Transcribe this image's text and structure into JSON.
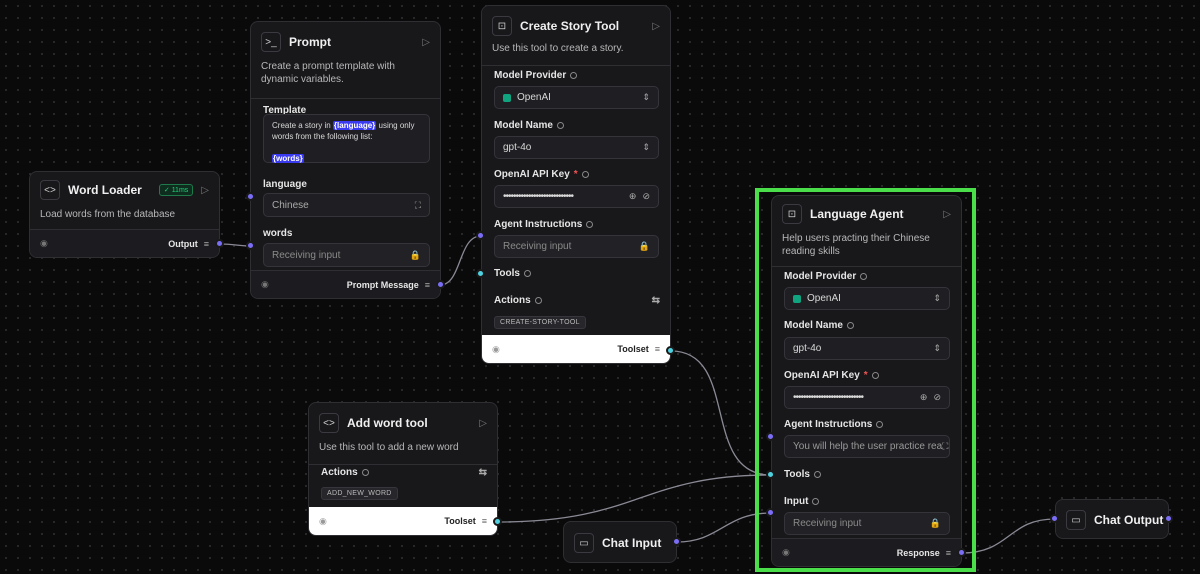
{
  "colors": {
    "accent": "#7b6ef6",
    "tool_port": "#4fd1e0",
    "selection": "#4ade4a",
    "success": "#1fd17a"
  },
  "word_loader": {
    "title": "Word Loader",
    "badge": "11ms",
    "desc": "Load words from the database",
    "output": "Output"
  },
  "prompt": {
    "title": "Prompt",
    "desc": "Create a prompt template with dynamic variables.",
    "template_label": "Template",
    "template_text_a": "Create a story in ",
    "template_var1": "{language}",
    "template_text_b": " using only words from the following list:",
    "template_var2": "{words}",
    "language_label": "language",
    "language_value": "Chinese",
    "words_label": "words",
    "words_placeholder": "Receiving input",
    "output": "Prompt Message"
  },
  "story_tool": {
    "title": "Create Story Tool",
    "desc": "Use this tool to create a story.",
    "model_provider_label": "Model Provider",
    "model_provider": "OpenAI",
    "model_name_label": "Model Name",
    "model_name": "gpt-4o",
    "api_key_label": "OpenAI API Key",
    "api_key_mask": "••••••••••••••••••••••••••••",
    "instructions_label": "Agent Instructions",
    "instructions_placeholder": "Receiving input",
    "tools_label": "Tools",
    "actions_label": "Actions",
    "action_tag": "CREATE-STORY-TOOL",
    "output": "Toolset"
  },
  "add_word": {
    "title": "Add word tool",
    "desc": "Use this tool to add a new word",
    "actions_label": "Actions",
    "action_tag": "ADD_NEW_WORD",
    "output": "Toolset"
  },
  "chat_input": {
    "title": "Chat Input"
  },
  "agent": {
    "title": "Language Agent",
    "desc": "Help users practing their Chinese reading skills",
    "model_provider_label": "Model Provider",
    "model_provider": "OpenAI",
    "model_name_label": "Model Name",
    "model_name": "gpt-4o",
    "api_key_label": "OpenAI API Key",
    "api_key_mask": "••••••••••••••••••••••••••••",
    "instructions_label": "Agent Instructions",
    "instructions_value": "You will help the user practice rea",
    "tools_label": "Tools",
    "input_label": "Input",
    "input_placeholder": "Receiving input",
    "output": "Response"
  },
  "chat_output": {
    "title": "Chat Output"
  },
  "icons": {
    "code": "code-icon",
    "terminal": "terminal-icon",
    "robot": "robot-icon",
    "chat": "chat-icon",
    "play": "play-icon",
    "eye": "eye-icon",
    "chevrons": "chevron-updown-icon",
    "expand": "expand-icon",
    "lock": "lock-icon",
    "globe": "globe-icon",
    "eye_off": "eye-off-icon",
    "sliders": "sliders-icon"
  }
}
